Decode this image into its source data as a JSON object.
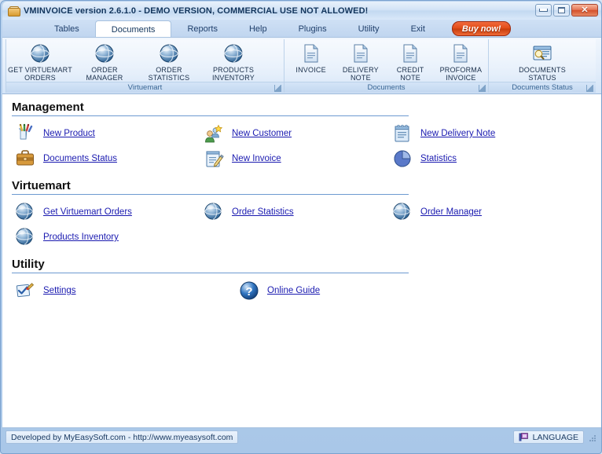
{
  "window": {
    "title": "VMINVOICE version 2.6.1.0 - DEMO VERSION, COMMERCIAL USE NOT ALLOWED!",
    "icon": "app-disk-icon",
    "buttons": {
      "minimize": "minimize-icon",
      "maximize": "maximize-icon",
      "close": "close-icon",
      "close_glyph": "✕"
    }
  },
  "menu": {
    "tabs": [
      {
        "label": "Tables",
        "active": false
      },
      {
        "label": "Documents",
        "active": true
      },
      {
        "label": "Reports",
        "active": false
      },
      {
        "label": "Help",
        "active": false
      },
      {
        "label": "Plugins",
        "active": false
      },
      {
        "label": "Utility",
        "active": false
      },
      {
        "label": "Exit",
        "active": false
      }
    ],
    "buy_now": "Buy now!",
    "buy_now_color": "#d4420f"
  },
  "ribbon": {
    "groups": [
      {
        "title": "Virtuemart",
        "items": [
          {
            "label": "GET VIRTUEMART\nORDERS",
            "icon": "globe-icon"
          },
          {
            "label": "ORDER MANAGER",
            "icon": "globe-icon"
          },
          {
            "label": "ORDER\nSTATISTICS",
            "icon": "globe-icon"
          },
          {
            "label": "PRODUCTS\nINVENTORY",
            "icon": "globe-icon"
          }
        ]
      },
      {
        "title": "Documents",
        "items": [
          {
            "label": "INVOICE",
            "icon": "document-page-icon"
          },
          {
            "label": "DELIVERY\nNOTE",
            "icon": "document-page-icon"
          },
          {
            "label": "CREDIT\nNOTE",
            "icon": "document-page-icon"
          },
          {
            "label": "PROFORMA\nINVOICE",
            "icon": "document-page-icon"
          }
        ]
      },
      {
        "title": "Documents Status",
        "items": [
          {
            "label": "DOCUMENTS\nSTATUS",
            "icon": "window-search-icon"
          }
        ]
      }
    ]
  },
  "main": {
    "sections": [
      {
        "heading": "Management",
        "links": [
          {
            "label": "New Product",
            "icon": "pencil-cup-icon"
          },
          {
            "label": "New Customer",
            "icon": "user-star-icon"
          },
          {
            "label": "New Delivery Note",
            "icon": "notepad-icon"
          },
          {
            "label": "Documents Status",
            "icon": "briefcase-icon"
          },
          {
            "label": "New Invoice",
            "icon": "notepad-pen-icon"
          },
          {
            "label": "Statistics",
            "icon": "pie-chart-icon"
          }
        ]
      },
      {
        "heading": "Virtuemart",
        "links": [
          {
            "label": "Get Virtuemart Orders",
            "icon": "globe-icon"
          },
          {
            "label": "Order Statistics",
            "icon": "globe-icon"
          },
          {
            "label": "Order Manager",
            "icon": "globe-icon"
          },
          {
            "label": "Products Inventory",
            "icon": "globe-icon"
          }
        ]
      },
      {
        "heading": "Utility",
        "links": [
          {
            "label": "Settings",
            "icon": "settings-check-icon"
          },
          {
            "label": "Online Guide",
            "icon": "help-question-icon"
          }
        ]
      }
    ],
    "link_color": "#1a1ab0"
  },
  "statusbar": {
    "developer": "Developed by MyEasySoft.com - http://www.myeasysoft.com",
    "language": "LANGUAGE",
    "language_icon": "flag-icon",
    "resize_grip": "resize-grip-icon"
  }
}
